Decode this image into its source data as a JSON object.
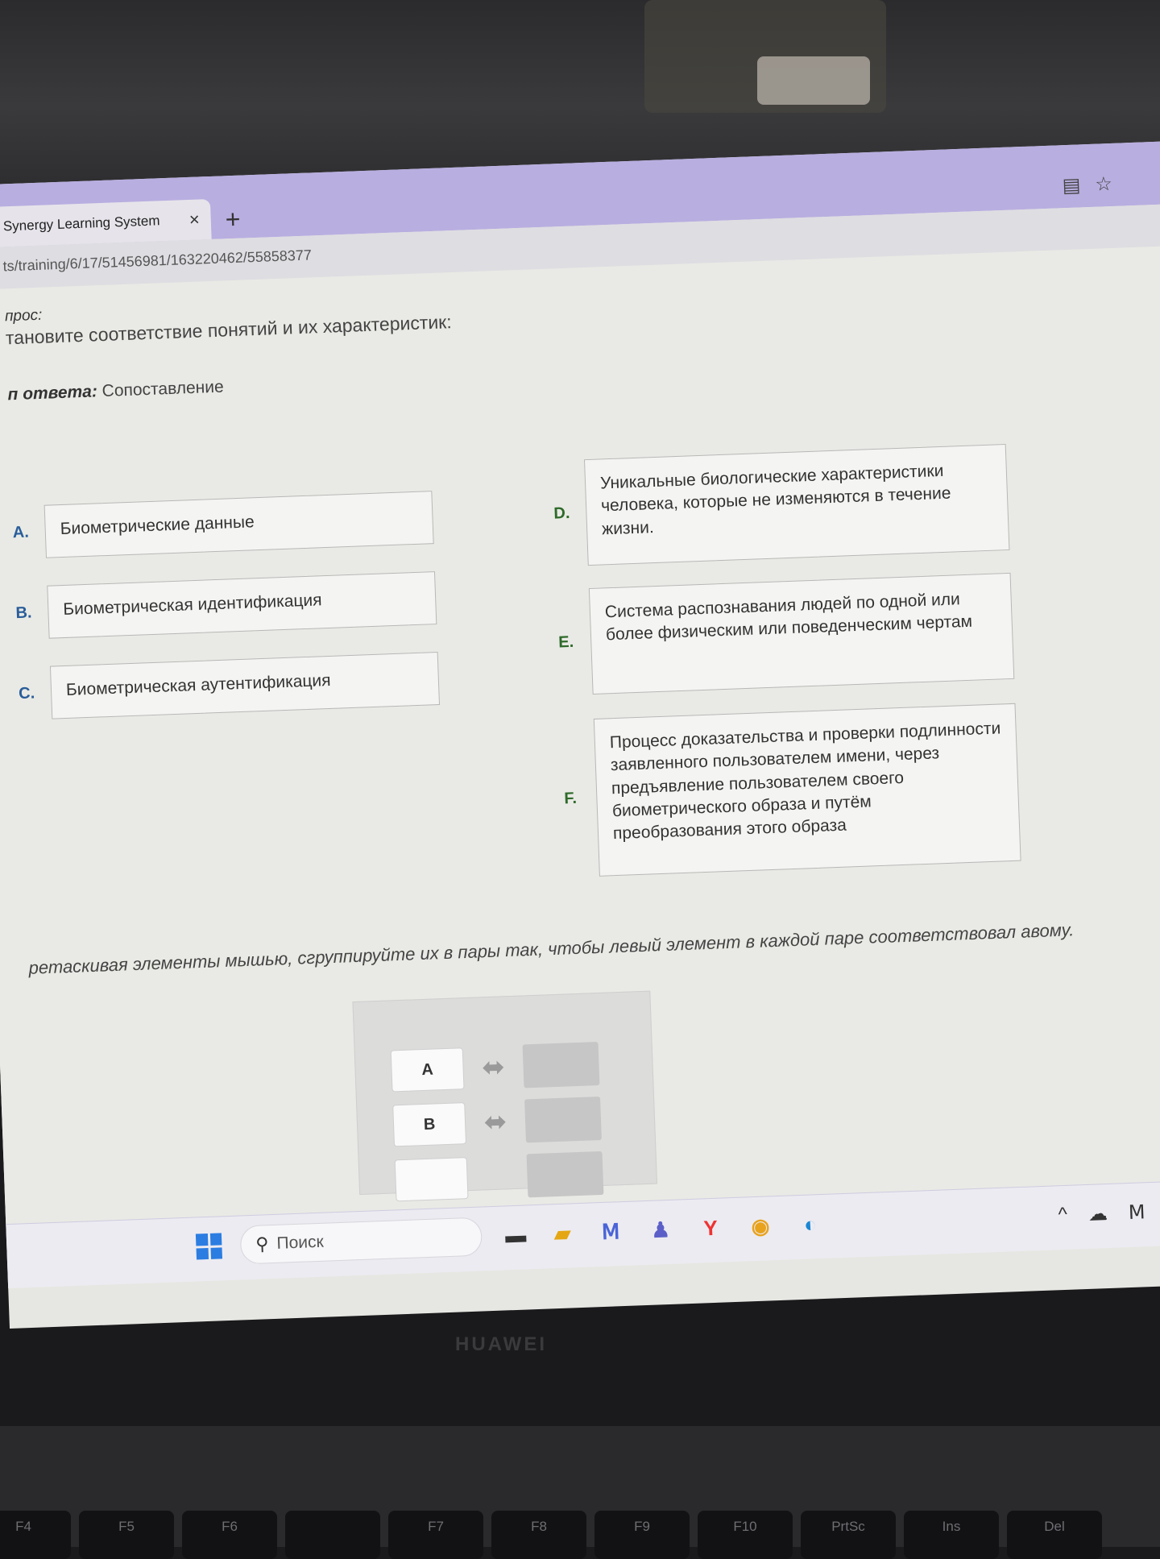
{
  "browser": {
    "tab_title": "Synergy Learning System",
    "tab_close": "×",
    "new_tab": "+",
    "url": "ts/training/6/17/51456981/163220462/55858377"
  },
  "question": {
    "label": "прос:",
    "text": "тановите соответствие понятий и их характеристик:",
    "type_label": "п ответа:",
    "type_value": "Сопоставление"
  },
  "left_items": [
    {
      "letter": "A.",
      "text": "Биометрические данные"
    },
    {
      "letter": "B.",
      "text": "Биометрическая идентификация"
    },
    {
      "letter": "C.",
      "text": "Биометрическая аутентификация"
    }
  ],
  "right_items": [
    {
      "letter": "D.",
      "text": "Уникальные биологические характеристики человека, которые не изменяются в течение жизни."
    },
    {
      "letter": "E.",
      "text": "Система распознавания людей по одной или более физическим или поведенческим чертам"
    },
    {
      "letter": "F.",
      "text": "Процесс доказательства и проверки подлинности заявленного пользователем имени, через предъявление пользователем своего биометрического образа и путём преобразования этого образа"
    }
  ],
  "instruction": "ретаскивая элементы мышью, сгруппируйте их в пары так, чтобы левый элемент в каждой паре соответствовал авому.",
  "dnd": {
    "rows": [
      {
        "source": "A",
        "arrow": "⬌"
      },
      {
        "source": "B",
        "arrow": "⬌"
      }
    ]
  },
  "taskbar": {
    "search_placeholder": "Поиск",
    "search_icon": "search-icon",
    "chevron": "^"
  },
  "device": {
    "brand": "HUAWEI",
    "keys": [
      "F4",
      "F5",
      "F6",
      "",
      "F7",
      "F8",
      "F9",
      "F10",
      "PrtSc",
      "Ins",
      "Del"
    ]
  }
}
